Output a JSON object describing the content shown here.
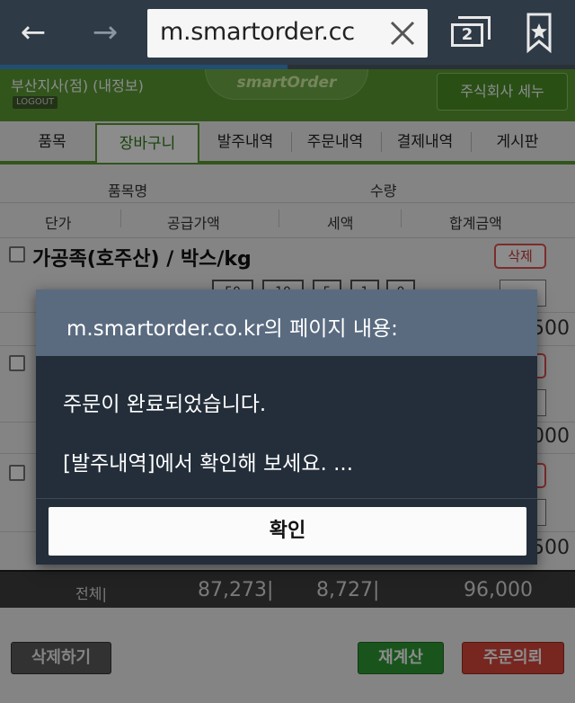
{
  "browser": {
    "url": "m.smartorder.cc",
    "tab_count": "2",
    "load_progress": 0.5
  },
  "header": {
    "branch": "부산지사(점) (내정보)",
    "logout": "LOGOUT",
    "logo": "smartOrder",
    "company": "주식회사 세누"
  },
  "tabs": [
    {
      "label": "품목"
    },
    {
      "label": "장바구니"
    },
    {
      "label": "발주내역"
    },
    {
      "label": "주문내역"
    },
    {
      "label": "결제내역"
    },
    {
      "label": "게시판"
    }
  ],
  "table_header": {
    "item_name": "품목명",
    "quantity": "수량",
    "unit_price": "단가",
    "supply_price": "공급가액",
    "tax": "세액",
    "total": "합계금액"
  },
  "items": [
    {
      "name": "가공족(호주산) / 박스/kg",
      "delete": "삭제",
      "qty_buttons": [
        "50",
        "10",
        "5",
        "1",
        "0"
      ],
      "total": "500"
    },
    {
      "name": "",
      "delete": "",
      "total": "000"
    },
    {
      "name": "",
      "delete": "",
      "total": "500"
    }
  ],
  "totals": {
    "label": "전체|",
    "supply": "87,273|",
    "tax": "8,727|",
    "total": "96,000"
  },
  "buttons": {
    "delete_all": "삭제하기",
    "recalc": "재계산",
    "order": "주문의뢰"
  },
  "dialog": {
    "title": "m.smartorder.co.kr의 페이지 내용:",
    "line1": "주문이 완료되었습니다.",
    "line2": "[발주내역]에서 확인해 보세요. ...",
    "ok": "확인"
  },
  "colors": {
    "browser_bar": "#2e3a46",
    "site_green": "#5c9c34",
    "dialog_bg": "#232e3a",
    "dialog_title_bg": "#5a6b80"
  }
}
